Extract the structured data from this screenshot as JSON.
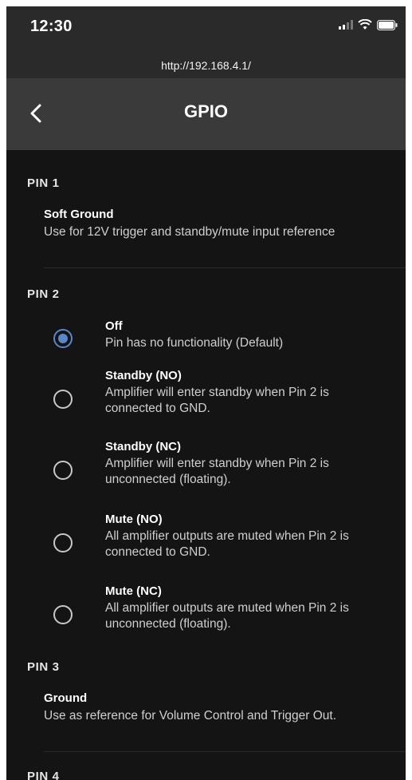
{
  "status": {
    "time": "12:30"
  },
  "browser": {
    "url": "http://192.168.4.1/"
  },
  "header": {
    "title": "GPIO"
  },
  "pins": [
    {
      "label": "PIN 1",
      "title": "Soft Ground",
      "desc": "Use for 12V trigger and standby/mute input reference"
    },
    {
      "label": "PIN 2"
    },
    {
      "label": "PIN 3",
      "title": "Ground",
      "desc": "Use as reference for Volume Control and Trigger Out."
    },
    {
      "label": "PIN 4"
    }
  ],
  "pin2_options": [
    {
      "title": "Off",
      "desc": "Pin has no functionality (Default)",
      "selected": true
    },
    {
      "title": "Standby (NO)",
      "desc": "Amplifier will enter standby when Pin 2 is connected to GND.",
      "selected": false
    },
    {
      "title": "Standby (NC)",
      "desc": "Amplifier will enter standby when Pin 2 is unconnected (floating).",
      "selected": false
    },
    {
      "title": "Mute (NO)",
      "desc": "All amplifier outputs are muted when Pin 2 is connected to GND.",
      "selected": false
    },
    {
      "title": "Mute (NC)",
      "desc": "All amplifier outputs are muted when Pin 2 is unconnected (floating).",
      "selected": false
    }
  ],
  "colors": {
    "accent": "#5b86c9",
    "background": "#141414",
    "header": "#3a3a3a"
  }
}
